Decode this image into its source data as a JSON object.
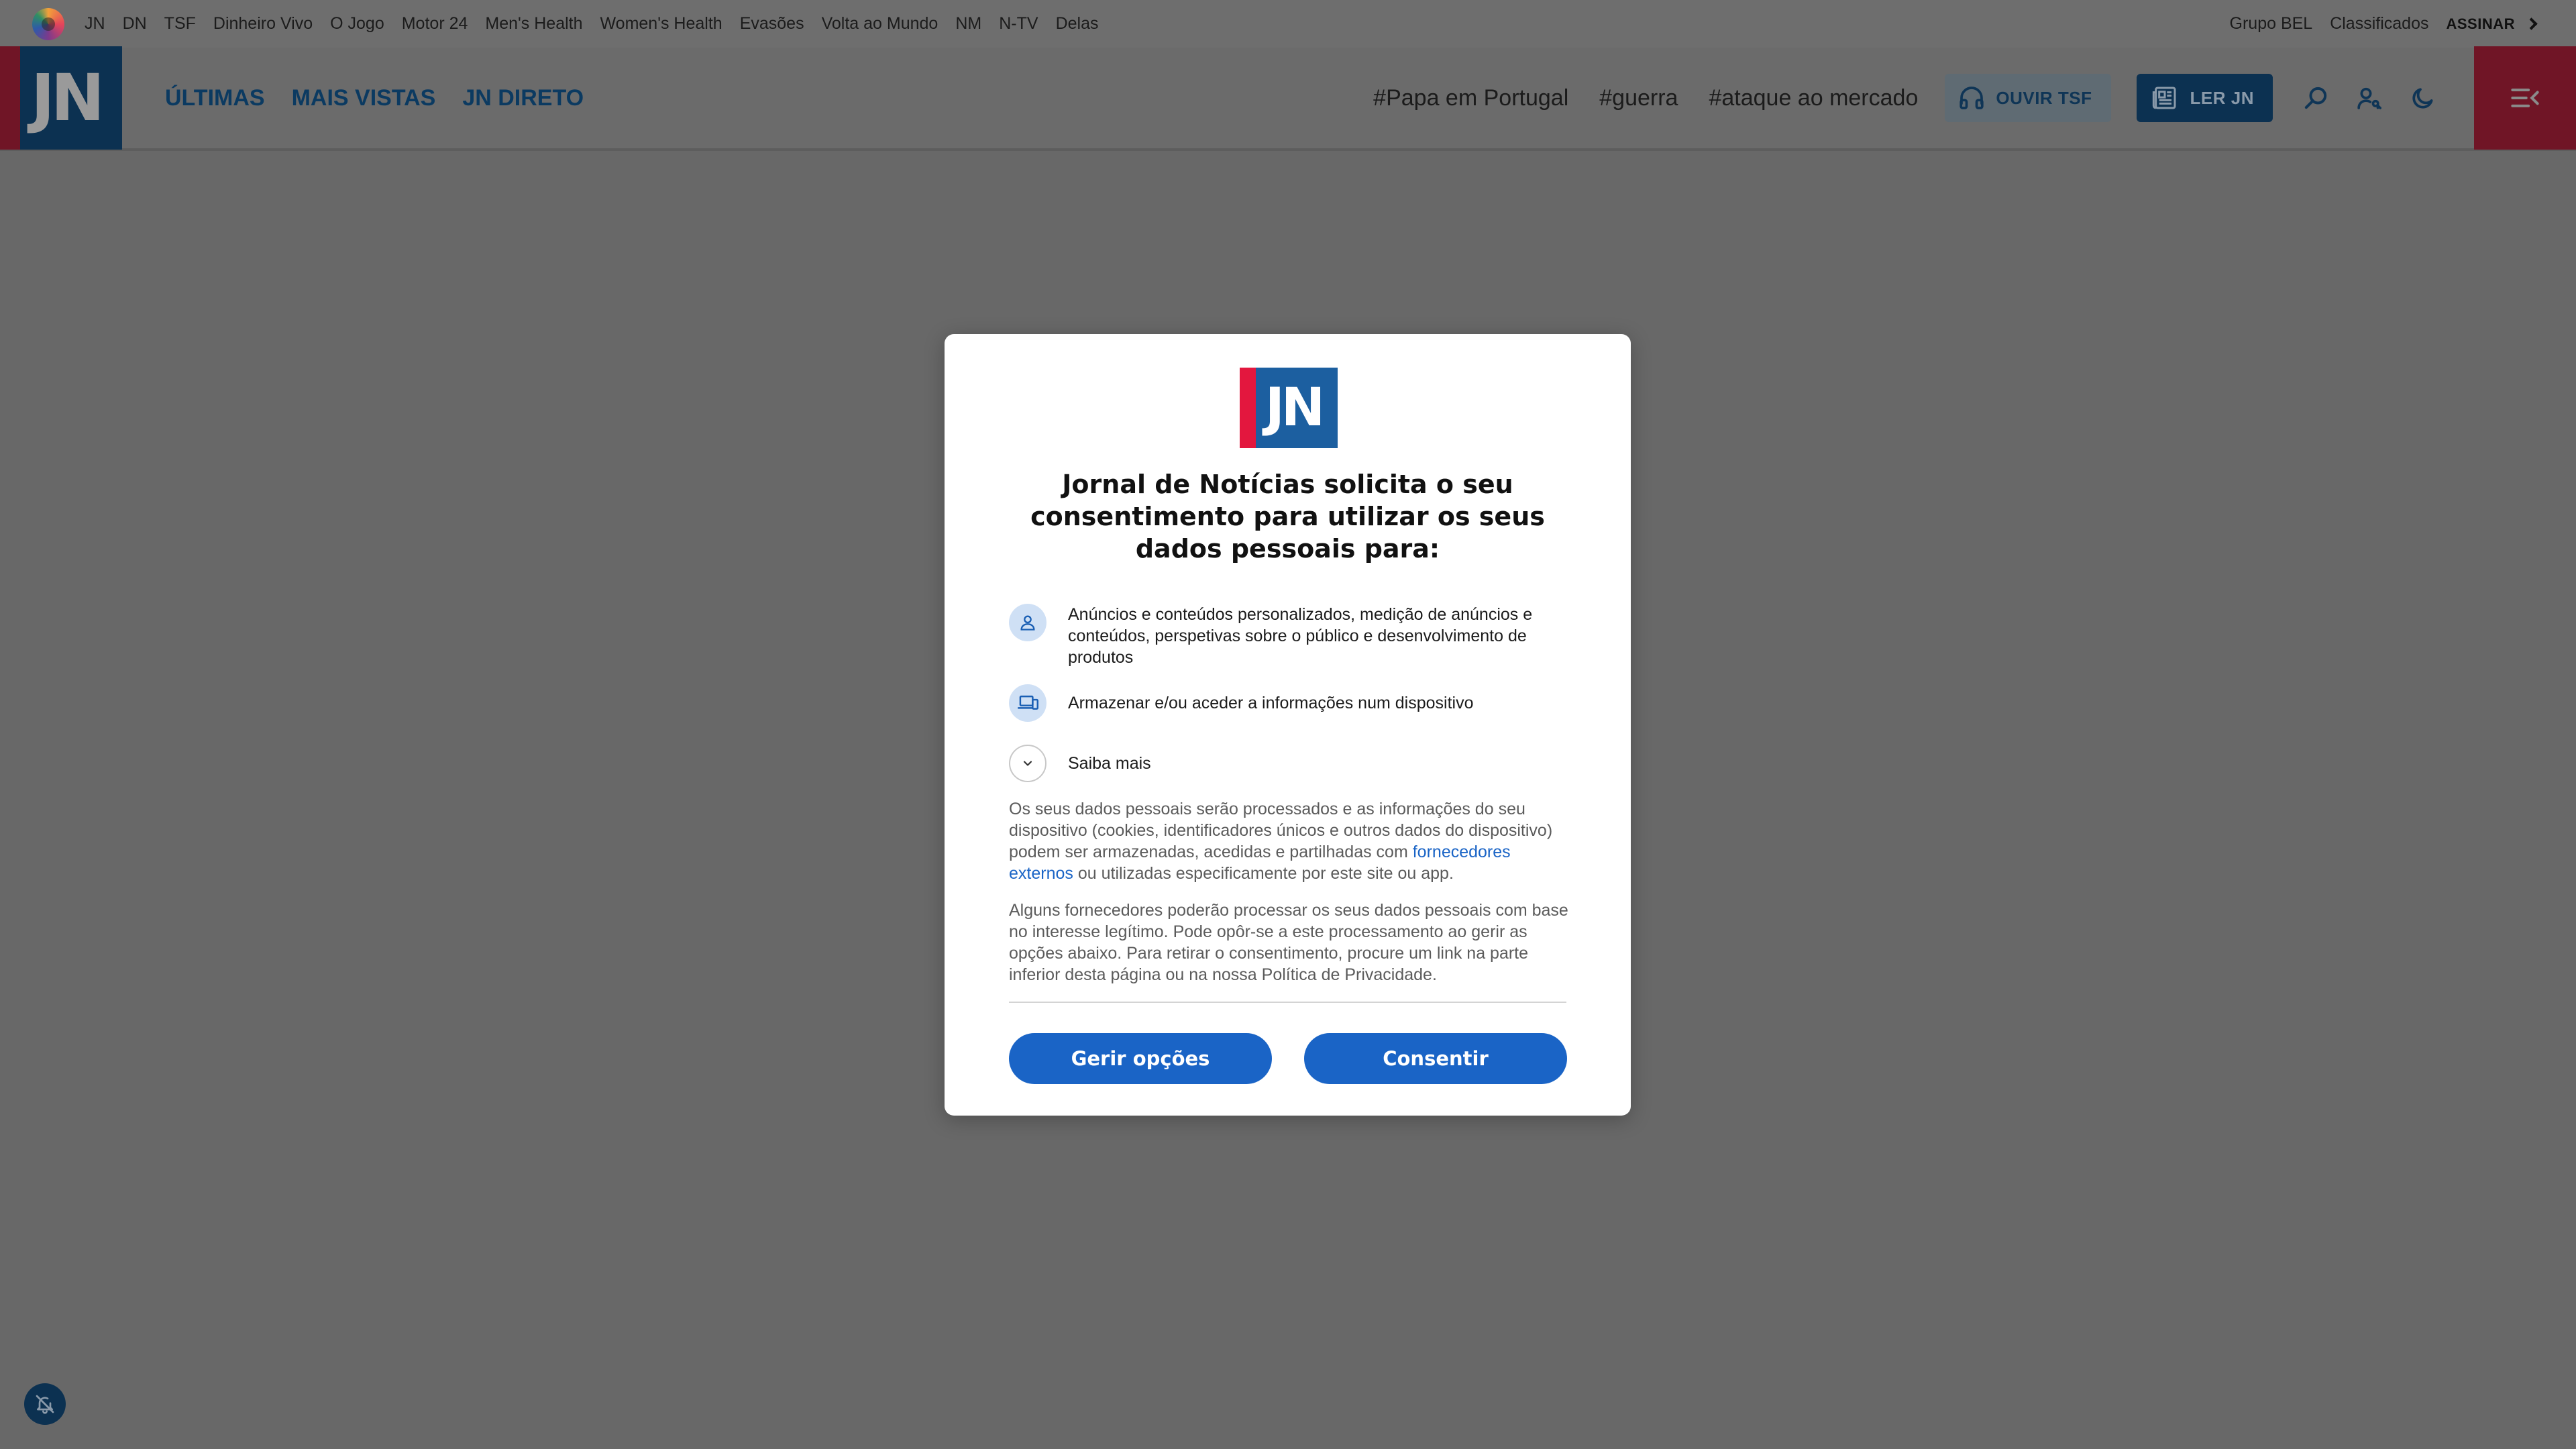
{
  "network_bar": {
    "links": [
      "JN",
      "DN",
      "TSF",
      "Dinheiro Vivo",
      "O Jogo",
      "Motor 24",
      "Men's Health",
      "Women's Health",
      "Evasões",
      "Volta ao Mundo",
      "NM",
      "N-TV",
      "Delas"
    ],
    "right_links": [
      "Grupo BEL",
      "Classificados"
    ],
    "subscribe_label": "ASSINAR"
  },
  "header": {
    "logo_text": "JN",
    "nav": [
      "ÚLTIMAS",
      "MAIS VISTAS",
      "JN DIRETO"
    ],
    "tags": [
      "#Papa em Portugal",
      "#guerra",
      "#ataque ao mercado"
    ],
    "listen_label": "OUVIR TSF",
    "read_label": "LER JN"
  },
  "consent": {
    "logo_text": "JN",
    "title": "Jornal de Notícias solicita o seu consentimento para utilizar os seus dados pessoais para:",
    "purposes": [
      {
        "icon": "person-icon",
        "text": "Anúncios e conteúdos personalizados, medição de anúncios e conteúdos, perspetivas sobre o público e desenvolvimento de produtos"
      },
      {
        "icon": "devices-icon",
        "text": "Armazenar e/ou aceder a informações num dispositivo"
      }
    ],
    "more_label": "Saiba mais",
    "paragraph1_before": "Os seus dados pessoais serão processados e as informações do seu dispositivo (cookies, identificadores únicos e outros dados do dispositivo) podem ser armazenadas, acedidas e partilhadas com ",
    "paragraph1_link": "fornecedores externos",
    "paragraph1_after": " ou utilizadas especificamente por este site ou app.",
    "paragraph2": "Alguns fornecedores poderão processar os seus dados pessoais com base no interesse legítimo. Pode opôr-se a este processamento ao gerir as opções abaixo. Para retirar o consentimento, procure um link na parte inferior desta página ou na nossa Política de Privacidade.",
    "manage_label": "Gerir opções",
    "consent_label": "Consentir"
  },
  "colors": {
    "overlay": "#686868",
    "jn_navy": "#0c3151",
    "jn_red": "#e3173e",
    "button_blue": "#1a64c6"
  }
}
